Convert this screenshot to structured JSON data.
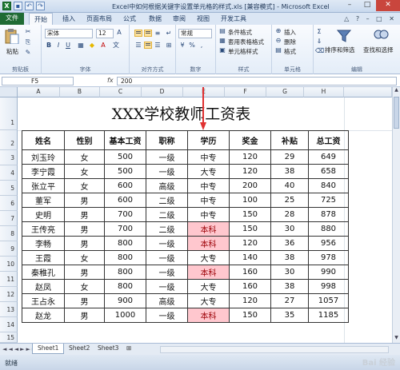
{
  "window": {
    "title": "Excel中如何根据关键字设置单元格的样式.xls [兼容模式] - Microsoft Excel"
  },
  "qat_icons": [
    "excel-logo-icon",
    "save-icon",
    "undo-icon",
    "redo-icon"
  ],
  "ribbon_tabs": [
    "文件",
    "开始",
    "插入",
    "页面布局",
    "公式",
    "数据",
    "审阅",
    "视图",
    "开发工具"
  ],
  "ribbon": {
    "paste": "粘贴",
    "font_name": "宋体",
    "font_size": "12",
    "wrap": "常规",
    "cond_format": "条件格式",
    "table_format": "套用表格格式",
    "cell_style": "单元格样式",
    "insert": "插入",
    "delete": "删除",
    "format": "格式",
    "sort_filter": "排序和筛选",
    "find_select": "查找和选择",
    "groups": [
      "剪贴板",
      "字体",
      "对齐方式",
      "数字",
      "样式",
      "单元格",
      "编辑"
    ]
  },
  "formula_bar": {
    "name_box": "F5",
    "fx": "fx",
    "content": "200"
  },
  "columns": [
    "A",
    "B",
    "C",
    "D",
    "E",
    "F",
    "G",
    "H"
  ],
  "rows": [
    "1",
    "2",
    "3",
    "4",
    "5",
    "6",
    "7",
    "8",
    "9",
    "10",
    "11",
    "12",
    "13",
    "14",
    "15"
  ],
  "sheet_title": "XXX学校教师工资表",
  "table": {
    "headers": [
      "姓名",
      "性别",
      "基本工资",
      "职称",
      "学历",
      "奖金",
      "补贴",
      "总工资"
    ],
    "rows": [
      [
        "刘玉玲",
        "女",
        "500",
        "一级",
        "中专",
        "120",
        "29",
        "649"
      ],
      [
        "李宁霞",
        "女",
        "500",
        "一级",
        "大专",
        "120",
        "38",
        "658"
      ],
      [
        "张立平",
        "女",
        "600",
        "高级",
        "中专",
        "200",
        "40",
        "840"
      ],
      [
        "董军",
        "男",
        "600",
        "二级",
        "中专",
        "100",
        "25",
        "725"
      ],
      [
        "史明",
        "男",
        "700",
        "二级",
        "中专",
        "150",
        "28",
        "878"
      ],
      [
        "王传亮",
        "男",
        "700",
        "二级",
        "本科",
        "150",
        "30",
        "880"
      ],
      [
        "李畅",
        "男",
        "800",
        "一级",
        "本科",
        "120",
        "36",
        "956"
      ],
      [
        "王霞",
        "女",
        "800",
        "一级",
        "大专",
        "140",
        "38",
        "978"
      ],
      [
        "秦稚孔",
        "男",
        "800",
        "一级",
        "本科",
        "160",
        "30",
        "990"
      ],
      [
        "赵凤",
        "女",
        "800",
        "一级",
        "大专",
        "160",
        "38",
        "998"
      ],
      [
        "王占永",
        "男",
        "900",
        "高级",
        "大专",
        "120",
        "27",
        "1057"
      ],
      [
        "赵龙",
        "男",
        "1000",
        "一级",
        "本科",
        "150",
        "35",
        "1185"
      ]
    ],
    "highlight_keyword": "本科",
    "highlight_color": "#ffc7ce"
  },
  "sheet_tabs": [
    "Sheet1",
    "Sheet2",
    "Sheet3"
  ],
  "status": {
    "ready": "就绪"
  },
  "watermark": "Bai 经验"
}
